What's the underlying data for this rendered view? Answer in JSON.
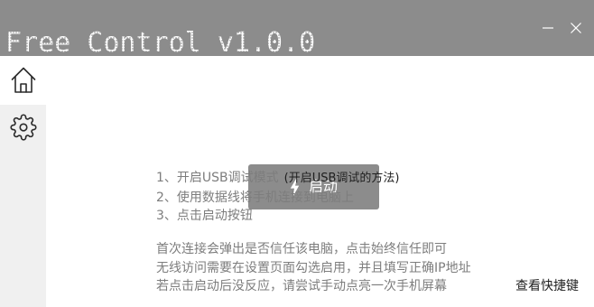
{
  "window": {
    "title": "Free Control v1.0.0",
    "minimize_icon": "minimize-icon",
    "close_icon": "close-icon"
  },
  "sidebar": {
    "items": [
      {
        "icon": "home-icon",
        "active": true
      },
      {
        "icon": "gear-icon",
        "active": false
      }
    ]
  },
  "main": {
    "start_button": {
      "icon": "lightning-icon",
      "label": "启动"
    },
    "steps": [
      {
        "text": "1、开启USB调试模式",
        "link": "(开启USB调试的方法)"
      },
      {
        "text": "2、使用数据线将手机连接到电脑上"
      },
      {
        "text": "3、点击启动按钮"
      }
    ],
    "notes": [
      "首次连接会弹出是否信任该电脑，点击始终信任即可",
      "无线访问需要在设置页面勾选启用，并且填写正确IP地址",
      "若点击启动后没反应，请尝试手动点亮一次手机屏幕"
    ],
    "shortcuts_link": "查看快捷键"
  },
  "colors": {
    "titlebar": "#8c8c8c",
    "button": "#8c8c8c",
    "sidebar": "#f0f0f0",
    "sidebar_active": "#ffffff",
    "main_bg": "#ffffff",
    "text_muted": "#7d7d7d",
    "text_dark": "#1f1f1f"
  }
}
